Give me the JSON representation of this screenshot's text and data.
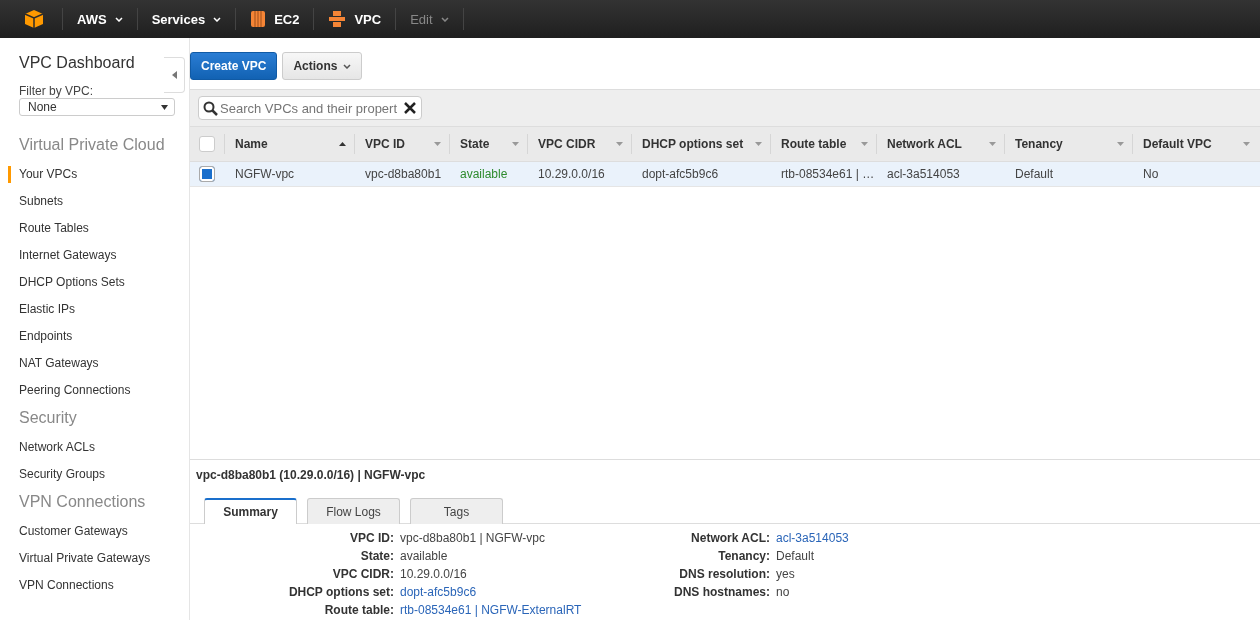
{
  "top_bar": {
    "items": [
      {
        "kind": "logo"
      },
      {
        "kind": "menu",
        "label": "AWS"
      },
      {
        "kind": "menu",
        "label": "Services"
      },
      {
        "kind": "compute",
        "label": "EC2"
      },
      {
        "kind": "network",
        "label": "VPC"
      },
      {
        "kind": "muted-menu",
        "label": "Edit"
      }
    ]
  },
  "sidebar": {
    "title": "VPC Dashboard",
    "filter": {
      "label": "Filter by VPC:",
      "value": "None"
    },
    "sections": [
      {
        "heading": "Virtual Private Cloud",
        "items": [
          {
            "label": "Your VPCs",
            "selected": true
          },
          {
            "label": "Subnets",
            "selected": false
          },
          {
            "label": "Route Tables",
            "selected": false
          },
          {
            "label": "Internet Gateways",
            "selected": false
          },
          {
            "label": "DHCP Options Sets",
            "selected": false
          },
          {
            "label": "Elastic IPs",
            "selected": false
          },
          {
            "label": "Endpoints",
            "selected": false
          },
          {
            "label": "NAT Gateways",
            "selected": false
          },
          {
            "label": "Peering Connections",
            "selected": false
          }
        ]
      },
      {
        "heading": "Security",
        "items": [
          {
            "label": "Network ACLs",
            "selected": false
          },
          {
            "label": "Security Groups",
            "selected": false
          }
        ]
      },
      {
        "heading": "VPN Connections",
        "items": [
          {
            "label": "Customer Gateways",
            "selected": false
          },
          {
            "label": "Virtual Private Gateways",
            "selected": false
          },
          {
            "label": "VPN Connections",
            "selected": false
          }
        ]
      }
    ]
  },
  "toolbar": {
    "primary": "Create VPC",
    "actions": "Actions"
  },
  "search": {
    "placeholder": "Search VPCs and their propert"
  },
  "table": {
    "all_selected": false,
    "columns": [
      {
        "label": "Name",
        "sorted": true
      },
      {
        "label": "VPC ID",
        "sorted": false
      },
      {
        "label": "State",
        "sorted": false
      },
      {
        "label": "VPC CIDR",
        "sorted": false
      },
      {
        "label": "DHCP options set",
        "sorted": false
      },
      {
        "label": "Route table",
        "sorted": false
      },
      {
        "label": "Network ACL",
        "sorted": false
      },
      {
        "label": "Tenancy",
        "sorted": false
      },
      {
        "label": "Default VPC",
        "sorted": false
      }
    ],
    "rows": [
      {
        "selected": true,
        "cells": [
          "NGFW-vpc",
          "vpc-d8ba80b1",
          "available",
          "10.29.0.0/16",
          "dopt-afc5b9c6",
          "rtb-08534e61 | …",
          "acl-3a514053",
          "Default",
          "No"
        ]
      }
    ]
  },
  "detail": {
    "title": "vpc-d8ba80b1 (10.29.0.0/16) | NGFW-vpc",
    "tabs": [
      {
        "label": "Summary",
        "selected": true
      },
      {
        "label": "Flow Logs",
        "selected": false
      },
      {
        "label": "Tags",
        "selected": false
      }
    ],
    "left": [
      {
        "label": "VPC ID:",
        "value": "vpc-d8ba80b1 | NGFW-vpc",
        "link": false
      },
      {
        "label": "State:",
        "value": "available",
        "link": false
      },
      {
        "label": "VPC CIDR:",
        "value": "10.29.0.0/16",
        "link": false
      },
      {
        "label": "DHCP options set:",
        "value": "dopt-afc5b9c6",
        "link": true
      },
      {
        "label": "Route table:",
        "value": "rtb-08534e61 | NGFW-ExternalRT",
        "link": true
      }
    ],
    "right": [
      {
        "label": "Network ACL:",
        "value": "acl-3a514053",
        "link": true
      },
      {
        "label": "Tenancy:",
        "value": "Default",
        "link": false
      },
      {
        "label": "DNS resolution:",
        "value": "yes",
        "link": false
      },
      {
        "label": "DNS hostnames:",
        "value": "no",
        "link": false
      }
    ]
  }
}
